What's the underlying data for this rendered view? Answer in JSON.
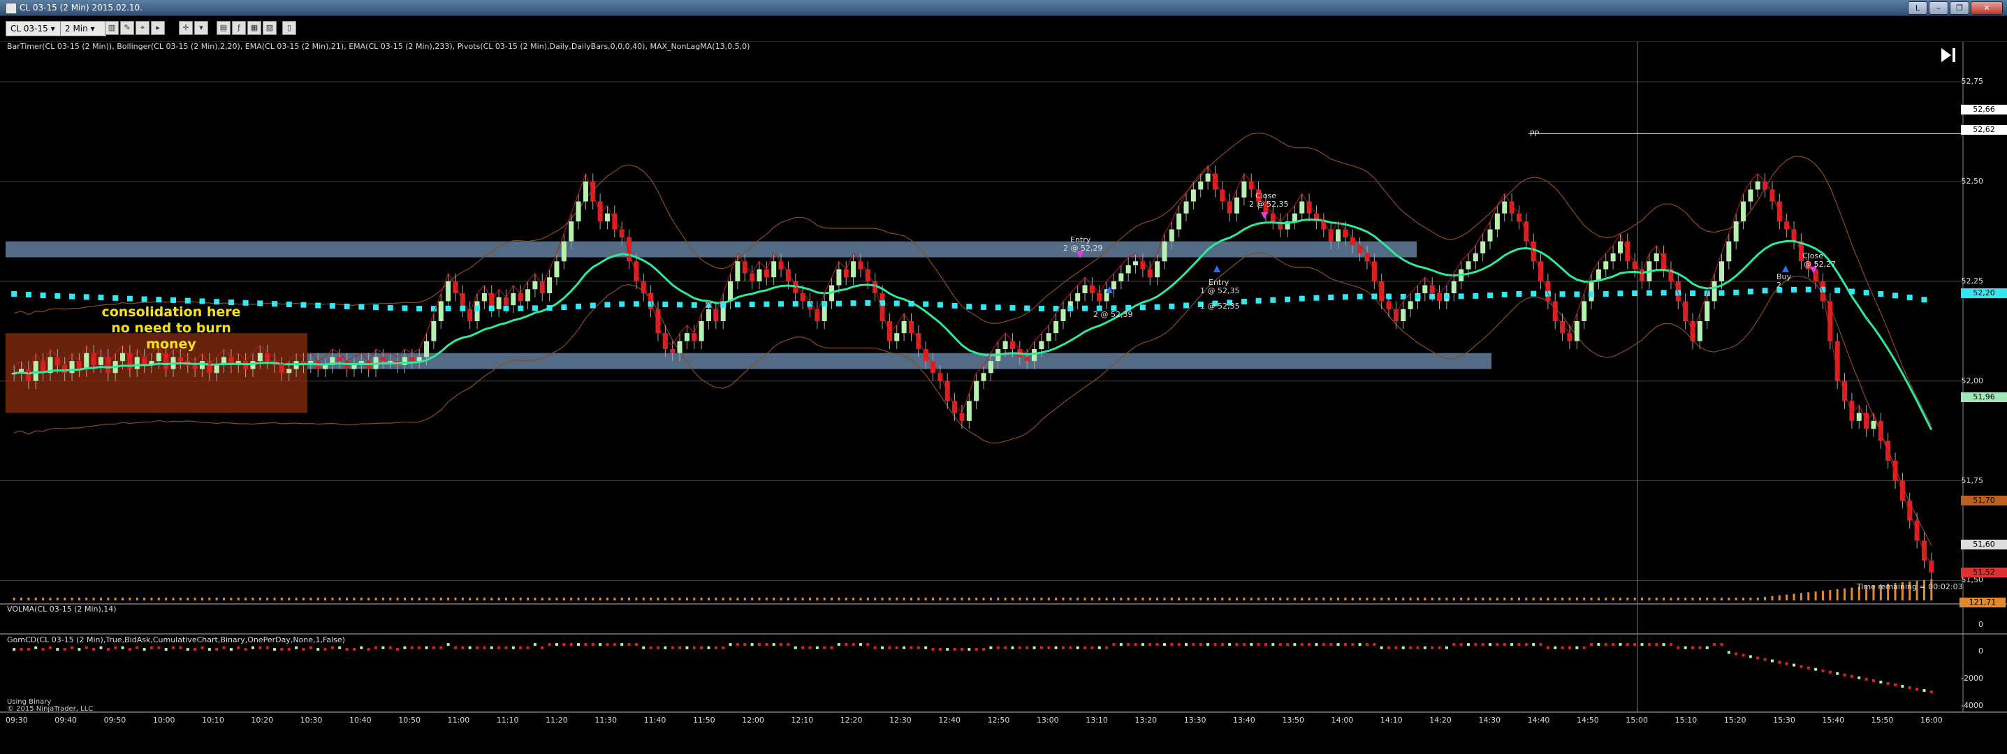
{
  "window": {
    "title": "CL 03-15 (2 Min)  2015.02.10.",
    "buttons": [
      "L",
      "–",
      "❐",
      "✕"
    ]
  },
  "toolbar": {
    "instrument": "CL 03-15",
    "interval": "2 Min"
  },
  "panels": {
    "price_title": "BarTimer(CL 03-15 (2 Min)), Bollinger(CL 03-15 (2 Min),2,20), EMA(CL 03-15 (2 Min),21), EMA(CL 03-15 (2 Min),233), Pivots(CL 03-15 (2 Min),Daily,DailyBars,0,0,0,40), MAX_NonLagMA(13,0.5,0)",
    "volume_title": "VOLMA(CL 03-15 (2 Min),14)",
    "delta_title": "GomCD(CL 03-15 (2 Min),True,BidAsk,CumulativeChart,Binary,OnePerDay,None,1,False)",
    "footer_line1": "Using Binary",
    "footer_line2": "© 2015 NinjaTrader, LLC"
  },
  "annotations": {
    "consolidation_line1": "consolidation here",
    "consolidation_line2": "no need to burn money",
    "pp": "PP",
    "time_remaining": "Time remaining = 00:02:03",
    "entry1_a": "Entry",
    "entry1_b": "2 @ 52,29",
    "entry1_c": "2 @ 52,39",
    "close1_a": "Close",
    "close1_b": "2 @ 52,35",
    "entry2_a": "Entry",
    "entry2_b": "1 @ 52,35",
    "entry2_c": "1 @ 52,35",
    "close2_a": "Close",
    "close2_b": "@ 52,27",
    "buy": "Buy",
    "buy2": "2"
  },
  "price_axis": {
    "labels": [
      "52,75",
      "52,50",
      "52,25",
      "52,00",
      "51,75",
      "51,50"
    ],
    "boxes": [
      {
        "text": "52,66",
        "color": "#ffffff"
      },
      {
        "text": "52,62",
        "color": "#ffffff"
      },
      {
        "text": "52,20",
        "color": "#33e8f2"
      },
      {
        "text": "51,96",
        "color": "#a0e8b8"
      },
      {
        "text": "51,70",
        "color": "#c06020"
      },
      {
        "text": "51,60",
        "color": "#dddddd"
      },
      {
        "text": "51,52",
        "color": "#e03030"
      }
    ]
  },
  "volume_axis": {
    "box": "121,71",
    "zero": "0"
  },
  "delta_axis": [
    "0",
    "-2000",
    "-4000"
  ],
  "time_axis": [
    "09:30",
    "09:40",
    "09:50",
    "10:00",
    "10:10",
    "10:20",
    "10:30",
    "10:40",
    "10:50",
    "11:00",
    "11:10",
    "11:20",
    "11:30",
    "11:40",
    "11:50",
    "12:00",
    "12:10",
    "12:20",
    "12:30",
    "12:40",
    "12:50",
    "13:00",
    "13:10",
    "13:20",
    "13:30",
    "13:40",
    "13:50",
    "14:00",
    "14:10",
    "14:20",
    "14:30",
    "14:40",
    "14:50",
    "15:00",
    "15:10",
    "15:20",
    "15:30",
    "15:40",
    "15:50",
    "16:00"
  ],
  "chart_data": {
    "type": "candlestick",
    "instrument": "CL 03-15",
    "interval": "2 Min",
    "ylim": [
      51.5,
      52.82
    ],
    "closes": [
      52.02,
      52.03,
      52.0,
      52.05,
      52.02,
      52.06,
      52.04,
      52.02,
      52.05,
      52.03,
      52.07,
      52.04,
      52.06,
      52.02,
      52.05,
      52.07,
      52.03,
      52.06,
      52.04,
      52.05,
      52.07,
      52.03,
      52.06,
      52.05,
      52.04,
      52.03,
      52.05,
      52.02,
      52.04,
      52.06,
      52.04,
      52.05,
      52.03,
      52.05,
      52.07,
      52.05,
      52.04,
      52.02,
      52.03,
      52.05,
      52.04,
      52.05,
      52.03,
      52.04,
      52.06,
      52.05,
      52.03,
      52.04,
      52.05,
      52.03,
      52.06,
      52.05,
      52.05,
      52.04,
      52.06,
      52.05,
      52.06,
      52.1,
      52.15,
      52.2,
      52.25,
      52.22,
      52.18,
      52.15,
      52.2,
      52.22,
      52.18,
      52.21,
      52.19,
      52.22,
      52.2,
      52.23,
      52.25,
      52.22,
      52.26,
      52.3,
      52.35,
      52.4,
      52.45,
      52.5,
      52.45,
      52.4,
      52.42,
      52.38,
      52.36,
      52.3,
      52.25,
      52.22,
      52.18,
      52.12,
      52.08,
      52.07,
      52.1,
      52.12,
      52.1,
      52.15,
      52.18,
      52.15,
      52.2,
      52.25,
      52.3,
      52.27,
      52.25,
      52.28,
      52.26,
      52.3,
      52.28,
      52.25,
      52.22,
      52.2,
      52.18,
      52.15,
      52.2,
      52.24,
      52.28,
      52.26,
      52.3,
      52.28,
      52.25,
      52.22,
      52.15,
      52.1,
      52.12,
      52.15,
      52.12,
      52.08,
      52.05,
      52.02,
      52.0,
      51.95,
      51.92,
      51.9,
      51.95,
      52.0,
      52.02,
      52.05,
      52.08,
      52.1,
      52.08,
      52.06,
      52.05,
      52.08,
      52.1,
      52.12,
      52.15,
      52.18,
      52.2,
      52.22,
      52.24,
      52.22,
      52.2,
      52.23,
      52.25,
      52.27,
      52.29,
      52.3,
      52.28,
      52.26,
      52.3,
      52.35,
      52.38,
      52.42,
      52.45,
      52.48,
      52.5,
      52.52,
      52.48,
      52.45,
      52.42,
      52.46,
      52.5,
      52.48,
      52.45,
      52.42,
      52.4,
      52.38,
      52.4,
      52.42,
      52.45,
      52.42,
      52.4,
      52.38,
      52.35,
      52.38,
      52.36,
      52.34,
      52.32,
      52.3,
      52.25,
      52.2,
      52.18,
      52.15,
      52.18,
      52.2,
      52.22,
      52.24,
      52.22,
      52.2,
      52.22,
      52.25,
      52.28,
      52.3,
      52.32,
      52.35,
      52.38,
      52.42,
      52.45,
      52.42,
      52.4,
      52.35,
      52.3,
      52.25,
      52.2,
      52.15,
      52.12,
      52.1,
      52.15,
      52.2,
      52.25,
      52.28,
      52.3,
      52.32,
      52.35,
      52.3,
      52.28,
      52.25,
      52.3,
      52.32,
      52.28,
      52.25,
      52.2,
      52.15,
      52.1,
      52.15,
      52.2,
      52.25,
      52.3,
      52.35,
      52.4,
      52.45,
      52.48,
      52.5,
      52.48,
      52.45,
      52.4,
      52.38,
      52.35,
      52.3,
      52.28,
      52.25,
      52.2,
      52.1,
      52.0,
      51.95,
      51.9,
      51.92,
      51.88,
      51.9,
      51.85,
      51.8,
      51.75,
      51.7,
      51.65,
      51.6,
      51.55,
      51.52
    ],
    "ema21_last": 51.96,
    "ema233_last": 52.2,
    "pivot_pp": 52.62,
    "volume_ma_last": 121.71,
    "delta_range": [
      -4000,
      500
    ]
  }
}
